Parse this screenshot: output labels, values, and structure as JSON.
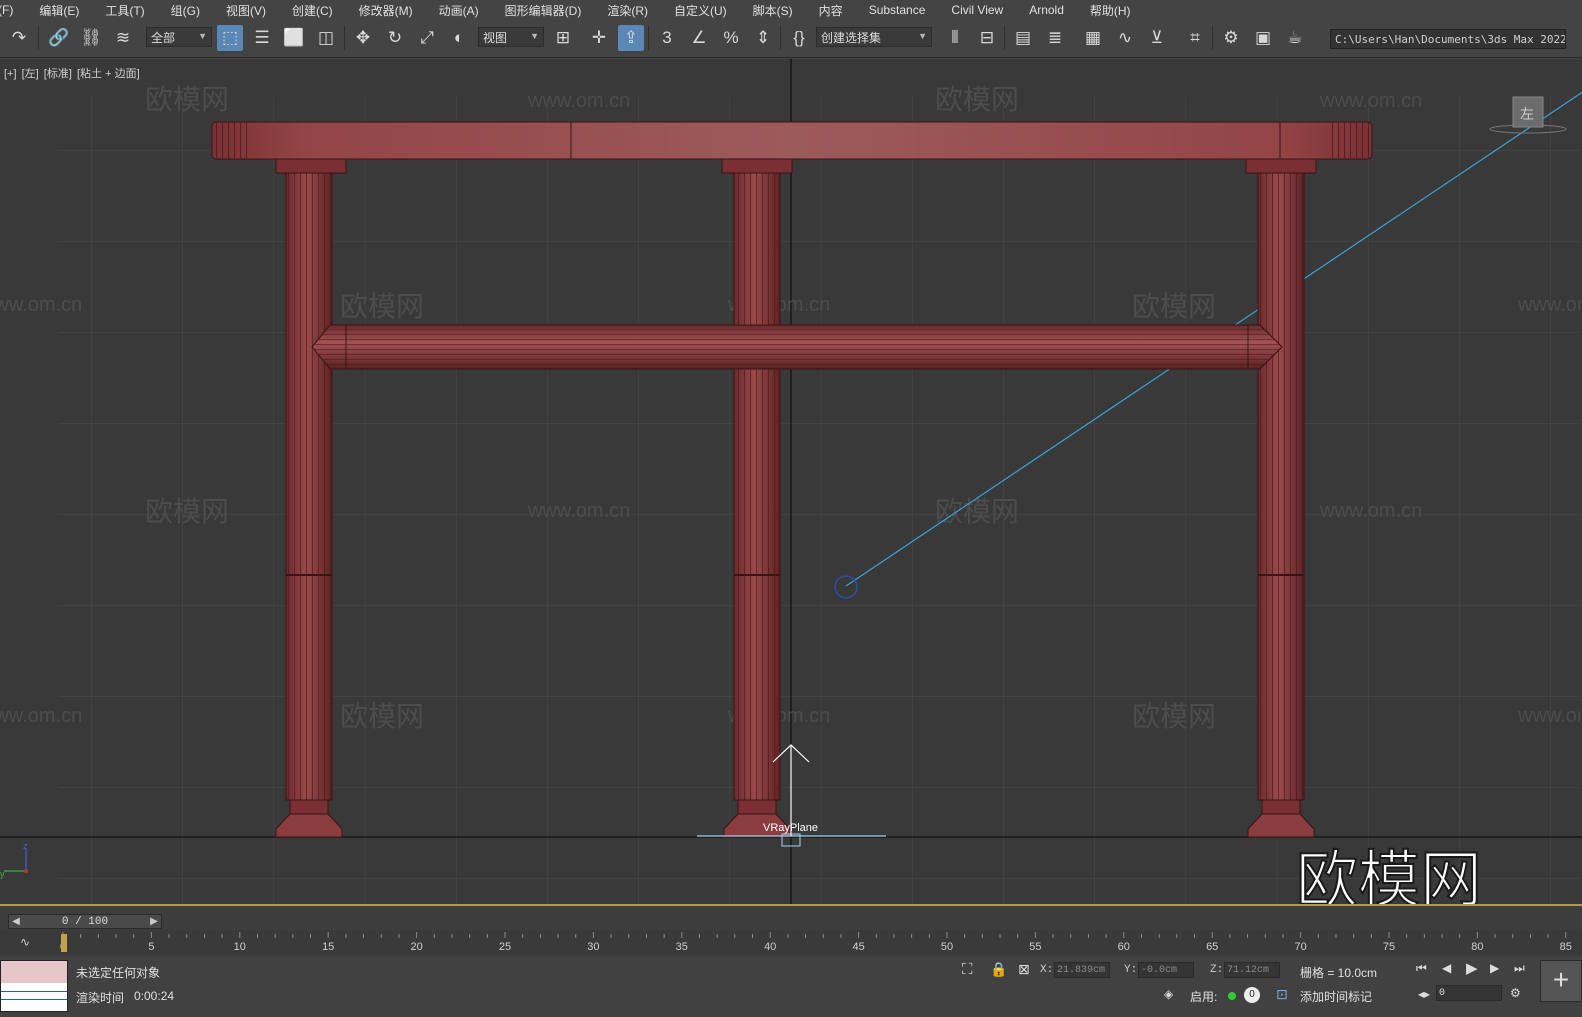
{
  "menu": [
    "(F)",
    "编辑(E)",
    "工具(T)",
    "组(G)",
    "视图(V)",
    "创建(C)",
    "修改器(M)",
    "动画(A)",
    "图形编辑器(D)",
    "渲染(R)",
    "自定义(U)",
    "脚本(S)",
    "内容",
    "Substance",
    "Civil View",
    "Arnold",
    "帮助(H)"
  ],
  "toolbar": {
    "filter_value": "全部",
    "refcoord_value": "视图",
    "selset_value": "创建选择集",
    "project_path": "C:\\Users\\Han\\Documents\\3ds Max 2022"
  },
  "viewport": {
    "labels": [
      "[+]",
      "[左]",
      "[标准]",
      "[粘土 + 边面]"
    ],
    "object_name": "VRayPlane",
    "watermark_site": "www.om.cn",
    "watermark_brand": "欧模网",
    "viewcube_face": "左",
    "axis_z": "z",
    "axis_y": "y"
  },
  "timeline": {
    "frame_display": "0 / 100",
    "ticks": [
      "0",
      "5",
      "10",
      "15",
      "20",
      "25",
      "30",
      "35",
      "40",
      "45",
      "50",
      "55",
      "60",
      "65",
      "70",
      "75",
      "80",
      "85"
    ]
  },
  "status": {
    "selection": "未选定任何对象",
    "render_time_label": "渲染时间",
    "render_time_value": "0:00:24",
    "x_label": "X:",
    "x_value": "21.839cm",
    "y_label": "Y:",
    "y_value": "-0.0cm",
    "z_label": "Z:",
    "z_value": "71.12cm",
    "grid": "栅格 = 10.0cm",
    "enable_label": "启用:",
    "enable_value": "0",
    "add_time_tag": "添加时间标记",
    "current_frame": "0"
  },
  "colors": {
    "object_fill": "#8e4345",
    "object_edge": "#3a1414",
    "grid_line": "#4b4b4b",
    "viewport_bg": "#393939",
    "light_line": "#3aa0d8",
    "active_button": "#5b87b6"
  }
}
